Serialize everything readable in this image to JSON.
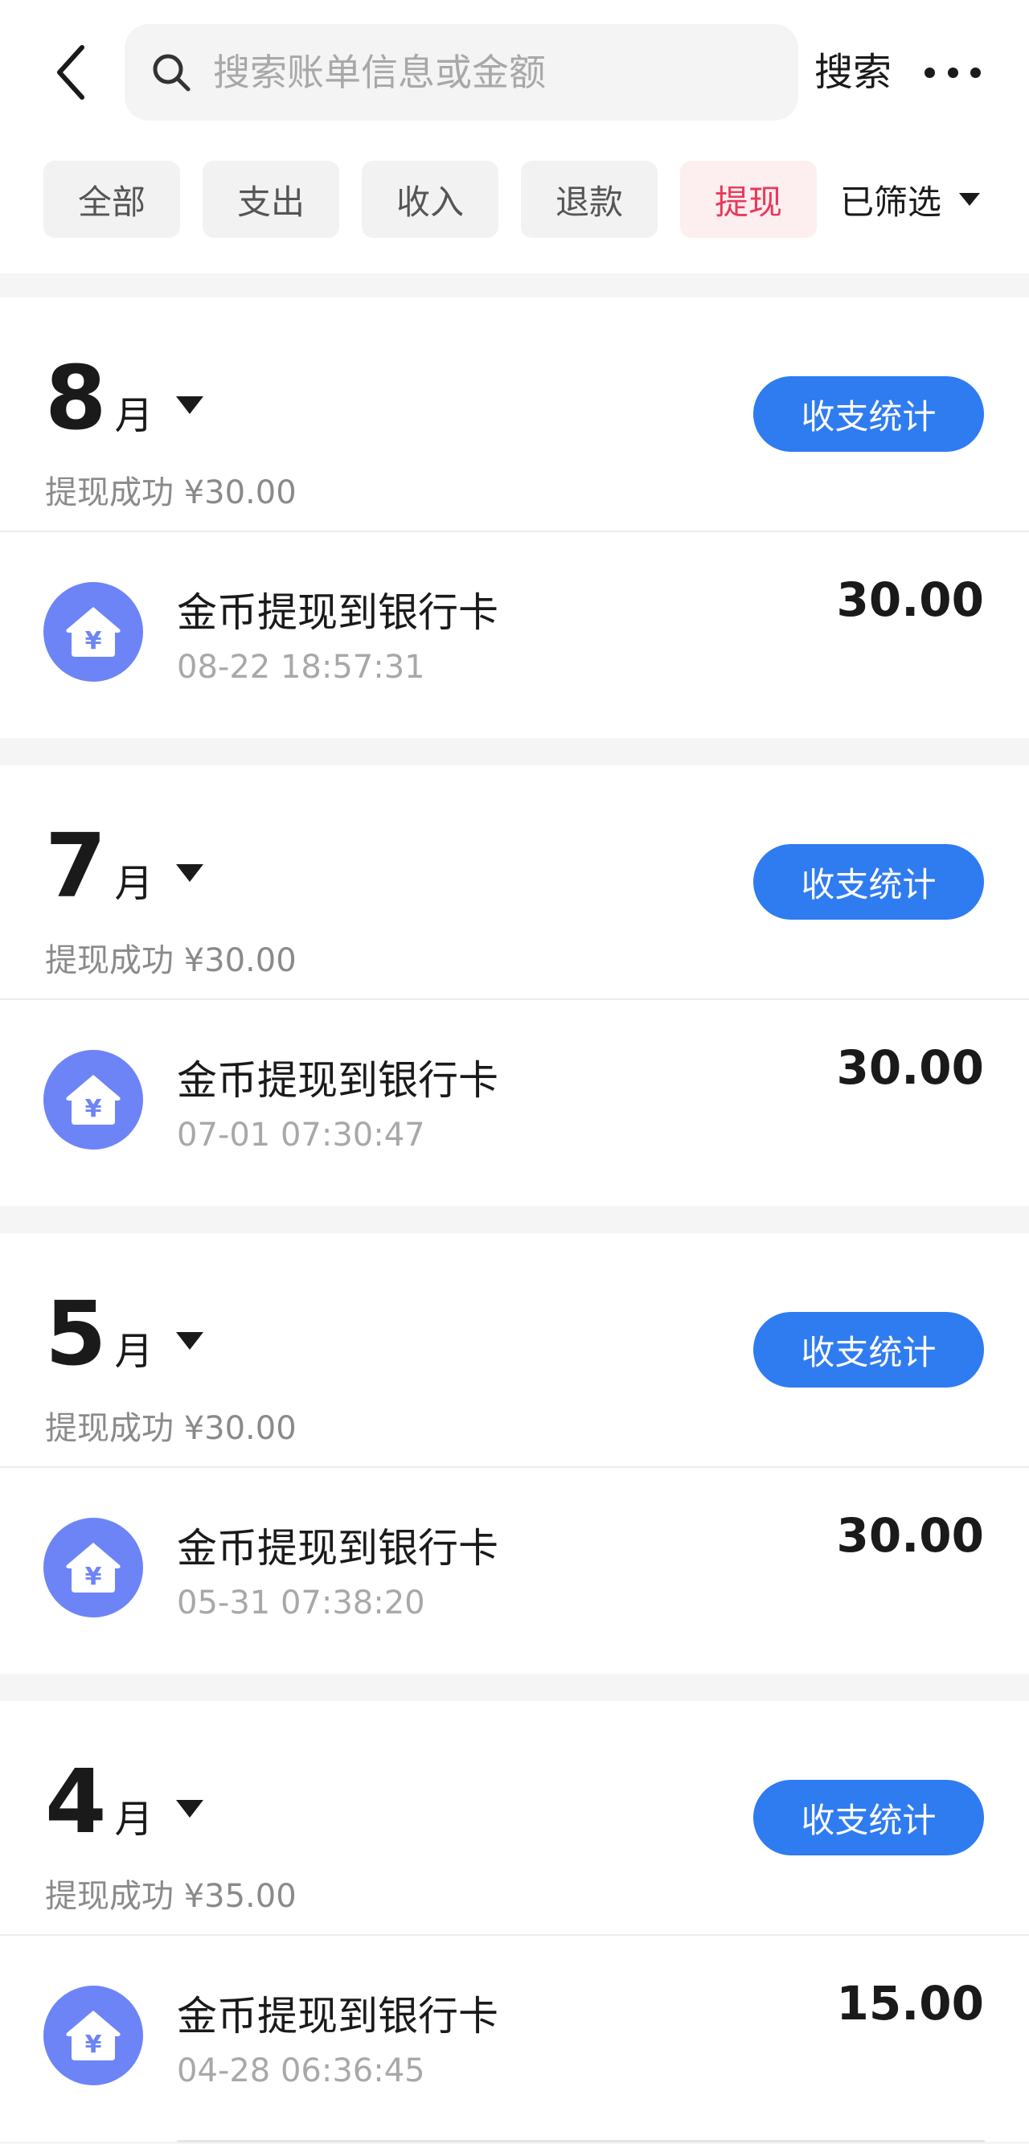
{
  "search": {
    "placeholder": "搜索账单信息或金额",
    "button_label": "搜索"
  },
  "filters": {
    "chips": [
      {
        "label": "全部",
        "active": false
      },
      {
        "label": "支出",
        "active": false
      },
      {
        "label": "收入",
        "active": false
      },
      {
        "label": "退款",
        "active": false
      },
      {
        "label": "提现",
        "active": true
      }
    ],
    "filtered_label": "已筛选"
  },
  "colors": {
    "accent_blue": "#2f7bf0",
    "active_chip_text": "#e63a5a",
    "active_chip_bg": "#fdeef0",
    "avatar_bg": "#6d84f7"
  },
  "icons": {
    "back": "chevron-left-icon",
    "search": "search-icon",
    "more": "more-dots-icon",
    "record": "house-yuan-icon"
  },
  "months": [
    {
      "month": "8",
      "unit": "月",
      "summary": "提现成功 ¥30.00",
      "stats_label": "收支统计",
      "records": [
        {
          "title": "金币提现到银行卡",
          "time": "08-22 18:57:31",
          "amount": "30.00"
        }
      ]
    },
    {
      "month": "7",
      "unit": "月",
      "summary": "提现成功 ¥30.00",
      "stats_label": "收支统计",
      "records": [
        {
          "title": "金币提现到银行卡",
          "time": "07-01 07:30:47",
          "amount": "30.00"
        }
      ]
    },
    {
      "month": "5",
      "unit": "月",
      "summary": "提现成功 ¥30.00",
      "stats_label": "收支统计",
      "records": [
        {
          "title": "金币提现到银行卡",
          "time": "05-31 07:38:20",
          "amount": "30.00"
        }
      ]
    },
    {
      "month": "4",
      "unit": "月",
      "summary": "提现成功 ¥35.00",
      "stats_label": "收支统计",
      "records": [
        {
          "title": "金币提现到银行卡",
          "time": "04-28 06:36:45",
          "amount": "15.00"
        }
      ]
    }
  ]
}
